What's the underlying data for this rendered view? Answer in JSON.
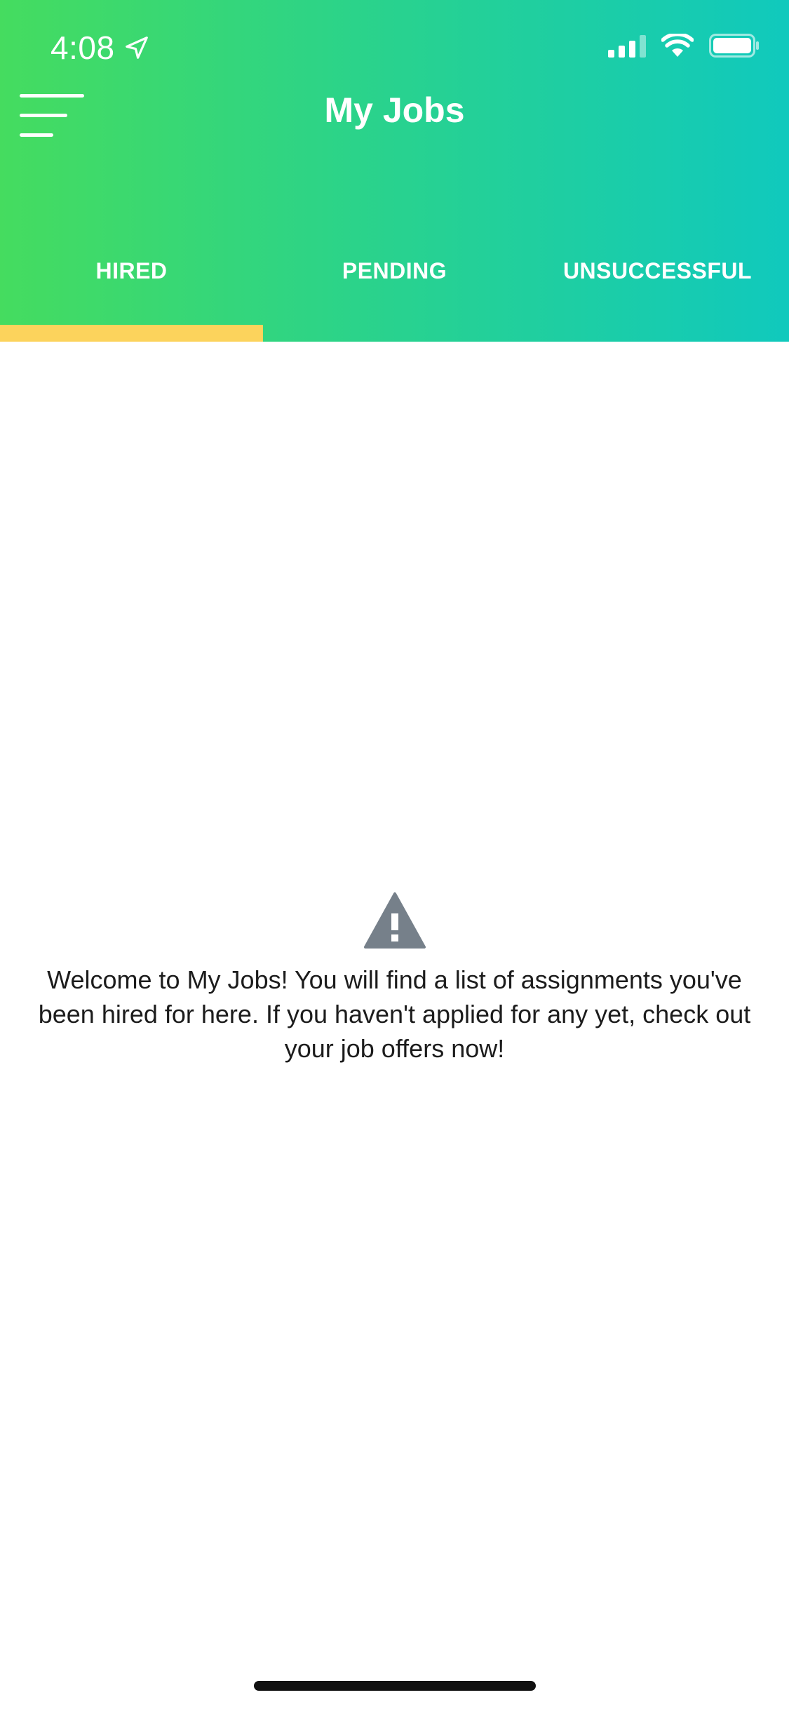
{
  "status_bar": {
    "time": "4:08",
    "icons": [
      "location-arrow-icon",
      "signal-icon",
      "wifi-icon",
      "battery-icon"
    ]
  },
  "header": {
    "title": "My Jobs",
    "menu_icon": "hamburger-menu-icon"
  },
  "tabs": [
    {
      "label": "HIRED",
      "active": true
    },
    {
      "label": "PENDING",
      "active": false
    },
    {
      "label": "UNSUCCESSFUL",
      "active": false
    }
  ],
  "empty_state": {
    "icon": "warning-icon",
    "message": "Welcome to My Jobs! You will find a list of assignments you've been hired for here. If you haven't applied for any yet, check out your job offers now!"
  },
  "colors": {
    "gradient_start": "#45dc5f",
    "gradient_end": "#10c9bd",
    "tab_indicator": "#fcd35c",
    "warning_icon": "#76808a",
    "text": "#1c1c1c"
  }
}
